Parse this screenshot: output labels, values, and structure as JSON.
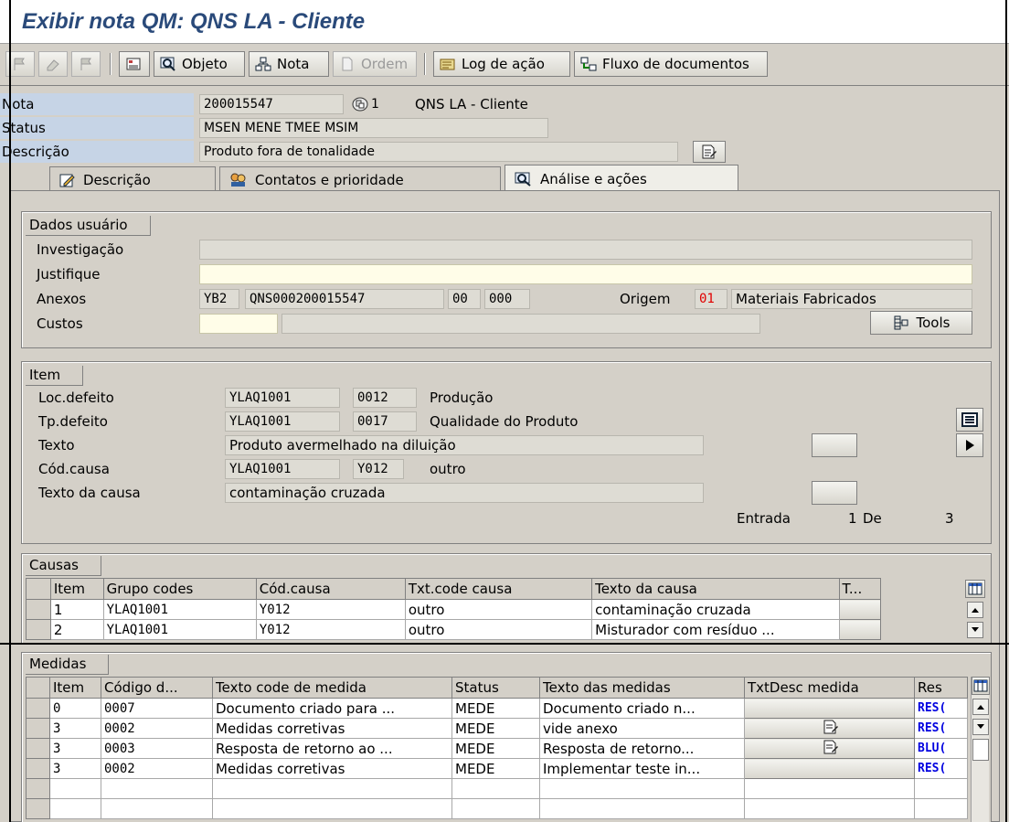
{
  "window": {
    "title": "Exibir nota QM: QNS LA - Cliente"
  },
  "toolbar": {
    "objeto": "Objeto",
    "nota": "Nota",
    "ordem": "Ordem",
    "log": "Log de ação",
    "fluxo": "Fluxo de documentos"
  },
  "header": {
    "nota_label": "Nota",
    "nota_value": "200015547",
    "nota_counter": "1",
    "nota_type": "QNS LA - Cliente",
    "status_label": "Status",
    "status_value": "MSEN MENE TMEE MSIM",
    "descricao_label": "Descrição",
    "descricao_value": "Produto fora de tonalidade"
  },
  "tabs": [
    {
      "label": "Descrição"
    },
    {
      "label": "Contatos e prioridade"
    },
    {
      "label": "Análise e ações"
    }
  ],
  "dados_usuario": {
    "title": "Dados usuário",
    "investigacao_label": "Investigação",
    "justifique_label": "Justifique",
    "anexos_label": "Anexos",
    "anexos_code": "YB2",
    "anexos_ref": "QNS000200015547",
    "anexos_n1": "00",
    "anexos_n2": "000",
    "origem_label": "Origem",
    "origem_code": "01",
    "origem_text": "Materiais Fabricados",
    "custos_label": "Custos",
    "tools_label": "Tools"
  },
  "item": {
    "title": "Item",
    "loc_label": "Loc.defeito",
    "loc_group": "YLAQ1001",
    "loc_code": "0012",
    "loc_text": "Produção",
    "tp_label": "Tp.defeito",
    "tp_group": "YLAQ1001",
    "tp_code": "0017",
    "tp_text": "Qualidade do Produto",
    "texto_label": "Texto",
    "texto_value": "Produto avermelhado na diluição",
    "cod_label": "Cód.causa",
    "cod_group": "YLAQ1001",
    "cod_code": "Y012",
    "cod_text": "outro",
    "textocausa_label": "Texto da causa",
    "textocausa_value": "contaminação cruzada",
    "entrada_label": "Entrada",
    "entrada_value": "1",
    "de_label": "De",
    "de_value": "3"
  },
  "causas": {
    "title": "Causas",
    "columns": [
      "Item",
      "Grupo codes",
      "Cód.causa",
      "Txt.code causa",
      "Texto da causa",
      "T..."
    ],
    "rows": [
      [
        "1",
        "YLAQ1001",
        "Y012",
        "outro",
        "contaminação cruzada"
      ],
      [
        "2",
        "YLAQ1001",
        "Y012",
        "outro",
        "Misturador com resíduo ..."
      ]
    ]
  },
  "medidas": {
    "title": "Medidas",
    "columns": [
      "Item",
      "Código d...",
      "Texto code de medida",
      "Status",
      "Texto das medidas",
      "TxtDesc medida",
      "Res"
    ],
    "rows": [
      [
        "0",
        "0007",
        "Documento criado para ...",
        "MEDE",
        "Documento criado n...",
        "",
        "RES("
      ],
      [
        "3",
        "0002",
        "Medidas corretivas",
        "MEDE",
        "vide anexo",
        "edit",
        "RES("
      ],
      [
        "3",
        "0003",
        "Resposta de retorno ao ...",
        "MEDE",
        "Resposta de retorno...",
        "edit",
        "BLU("
      ],
      [
        "3",
        "0002",
        "Medidas corretivas",
        "MEDE",
        "Implementar teste in...",
        "",
        "RES("
      ]
    ]
  },
  "colors": {
    "title_text": "#2a4a7a",
    "header_label_bg": "#c6d4e6",
    "origem_code": "#e00000",
    "res_link": "#0000e0"
  }
}
